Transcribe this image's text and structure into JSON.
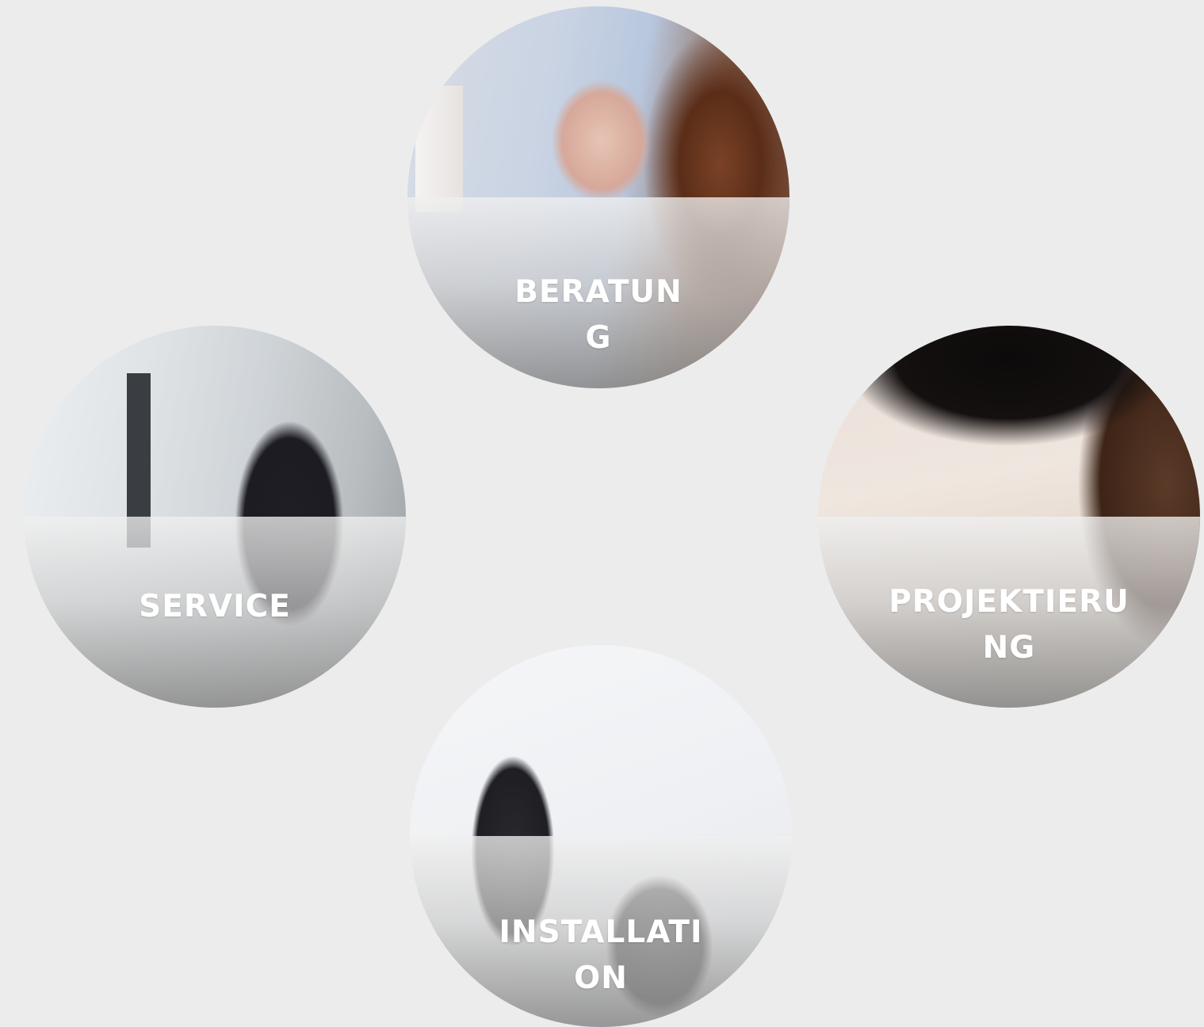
{
  "services": [
    {
      "id": "beratung",
      "label": "BERATUNG"
    },
    {
      "id": "service",
      "label": "SERVICE"
    },
    {
      "id": "projektierung",
      "label": "PROJEKTIERUNG"
    },
    {
      "id": "installation",
      "label": "INSTALLATION"
    }
  ]
}
